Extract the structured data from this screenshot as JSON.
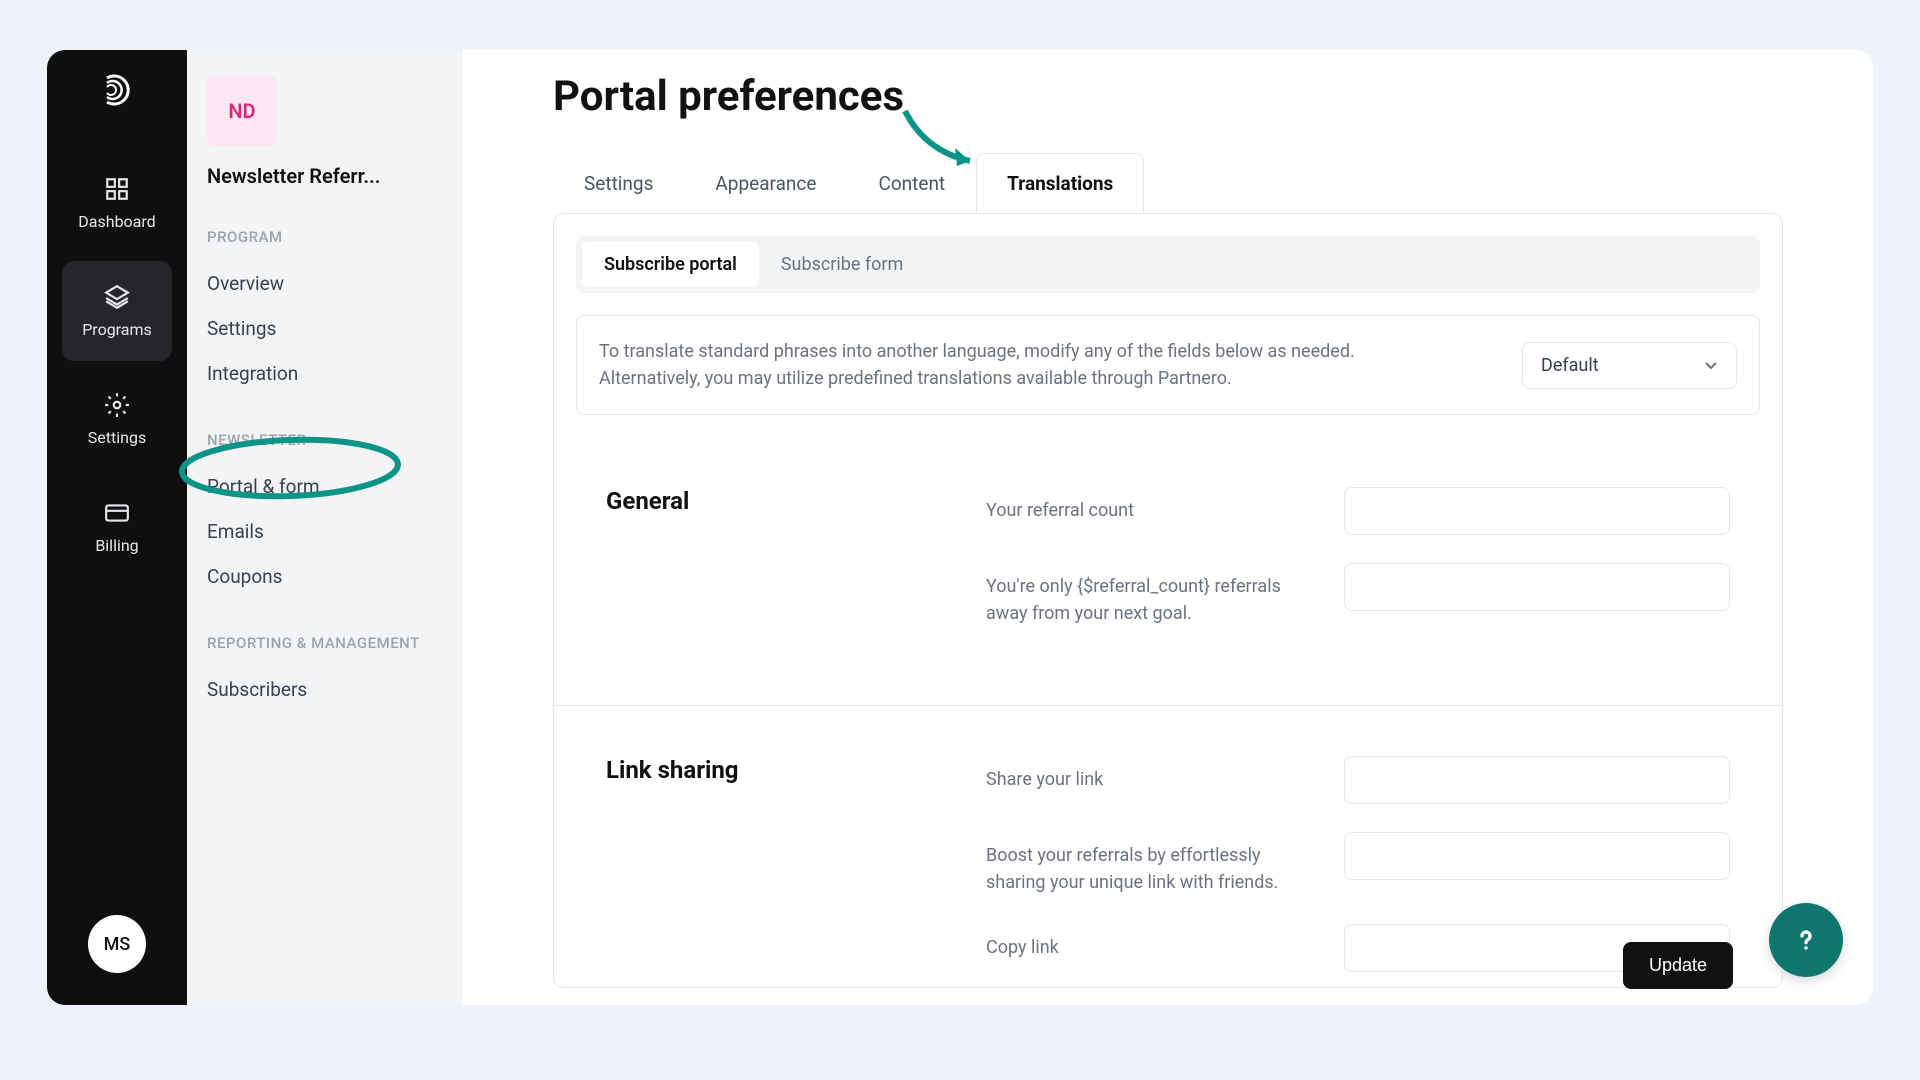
{
  "nav": {
    "dashboard": "Dashboard",
    "programs": "Programs",
    "settings": "Settings",
    "billing": "Billing"
  },
  "user_initials": "MS",
  "sidebar": {
    "program_badge": "ND",
    "program_name": "Newsletter Referr...",
    "section_program": "PROGRAM",
    "section_newsletter": "NEWSLETTER",
    "section_reporting": "REPORTING & MANAGEMENT",
    "links": {
      "overview": "Overview",
      "settings": "Settings",
      "integration": "Integration",
      "portal_form": "Portal & form",
      "emails": "Emails",
      "coupons": "Coupons",
      "subscribers": "Subscribers"
    }
  },
  "page": {
    "title": "Portal preferences",
    "tabs": {
      "settings": "Settings",
      "appearance": "Appearance",
      "content": "Content",
      "translations": "Translations"
    },
    "subtabs": {
      "subscribe_portal": "Subscribe portal",
      "subscribe_form": "Subscribe form"
    },
    "info_text": "To translate standard phrases into another language, modify any of the fields below as needed. Alternatively, you may utilize predefined translations available through Partnero.",
    "language_selected": "Default",
    "groups": {
      "general": {
        "title": "General",
        "fields": {
          "referral_count": "Your referral count",
          "referral_away": "You're only {$referral_count} referrals away from your next goal."
        }
      },
      "link_sharing": {
        "title": "Link sharing",
        "fields": {
          "share": "Share your link",
          "boost": "Boost your referrals by effortlessly sharing your unique link with friends.",
          "copy": "Copy link"
        }
      }
    },
    "update_label": "Update"
  }
}
